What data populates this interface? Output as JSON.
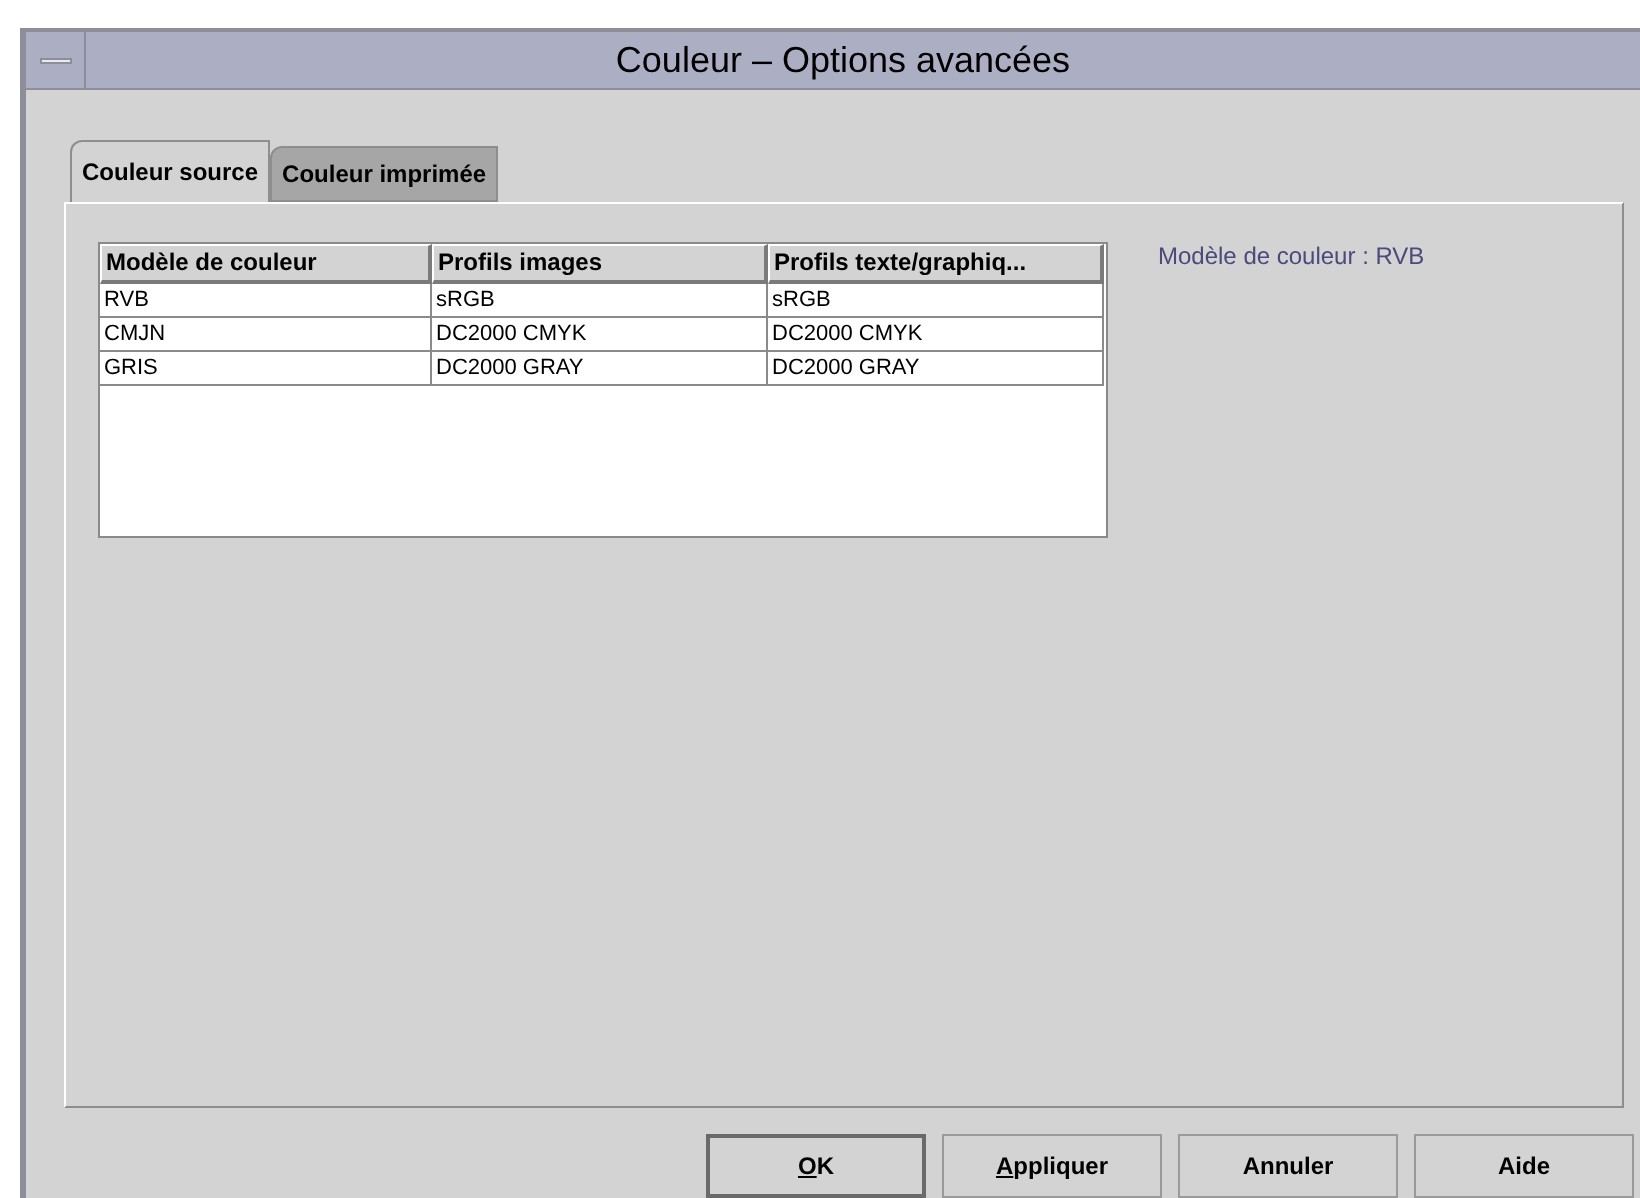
{
  "window": {
    "title": "Couleur – Options avancées"
  },
  "tabs": [
    {
      "label": "Couleur source",
      "selected": true
    },
    {
      "label": "Couleur imprimée",
      "selected": false
    }
  ],
  "table": {
    "columns": [
      "Modèle de couleur",
      "Profils images",
      "Profils texte/graphiq..."
    ],
    "rows": [
      [
        "RVB",
        "sRGB",
        "sRGB"
      ],
      [
        "CMJN",
        "DC2000 CMYK",
        "DC2000 CMYK"
      ],
      [
        "GRIS",
        "DC2000 GRAY",
        "DC2000 GRAY"
      ]
    ]
  },
  "info_label": "Modèle de couleur : RVB",
  "buttons": [
    {
      "label": "OK",
      "mnemonic": true,
      "default": true
    },
    {
      "label": "Appliquer",
      "mnemonic": true,
      "default": false
    },
    {
      "label": "Annuler",
      "mnemonic": false,
      "default": false
    },
    {
      "label": "Aide",
      "mnemonic": false,
      "default": false
    }
  ]
}
